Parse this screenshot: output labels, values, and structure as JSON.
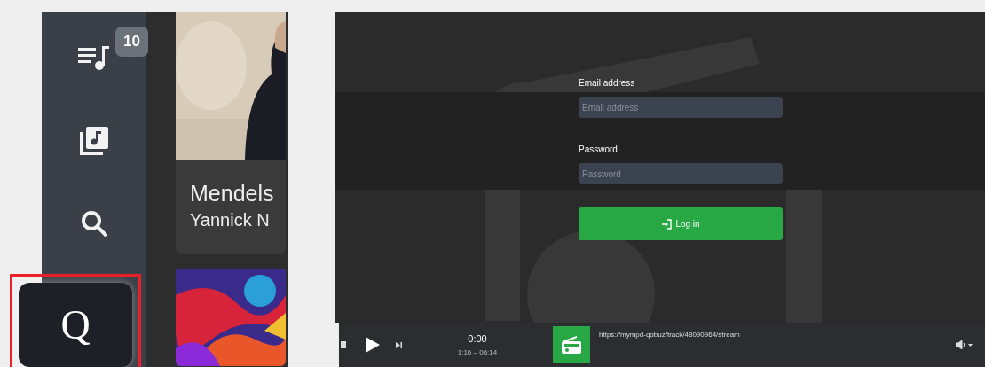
{
  "sidebar": {
    "items": [
      {
        "kind": "queue",
        "badge": "10",
        "selected": false
      },
      {
        "kind": "library",
        "selected": false
      },
      {
        "kind": "search",
        "selected": false
      },
      {
        "kind": "qobuz",
        "label": "Q",
        "selected": true
      }
    ]
  },
  "albums": [
    {
      "kind": "portrait",
      "title": "Mendels",
      "artist": "Yannick N"
    },
    {
      "kind": "abstract"
    }
  ],
  "login": {
    "email_label": "Email address",
    "email_placeholder": "Email address",
    "password_label": "Password",
    "password_placeholder": "Password",
    "button": "Log in"
  },
  "player": {
    "elapsed": "0:00",
    "duration": "1:16 – 06:14",
    "url": "https://mympd-qobuz/track/48090964/stream"
  }
}
